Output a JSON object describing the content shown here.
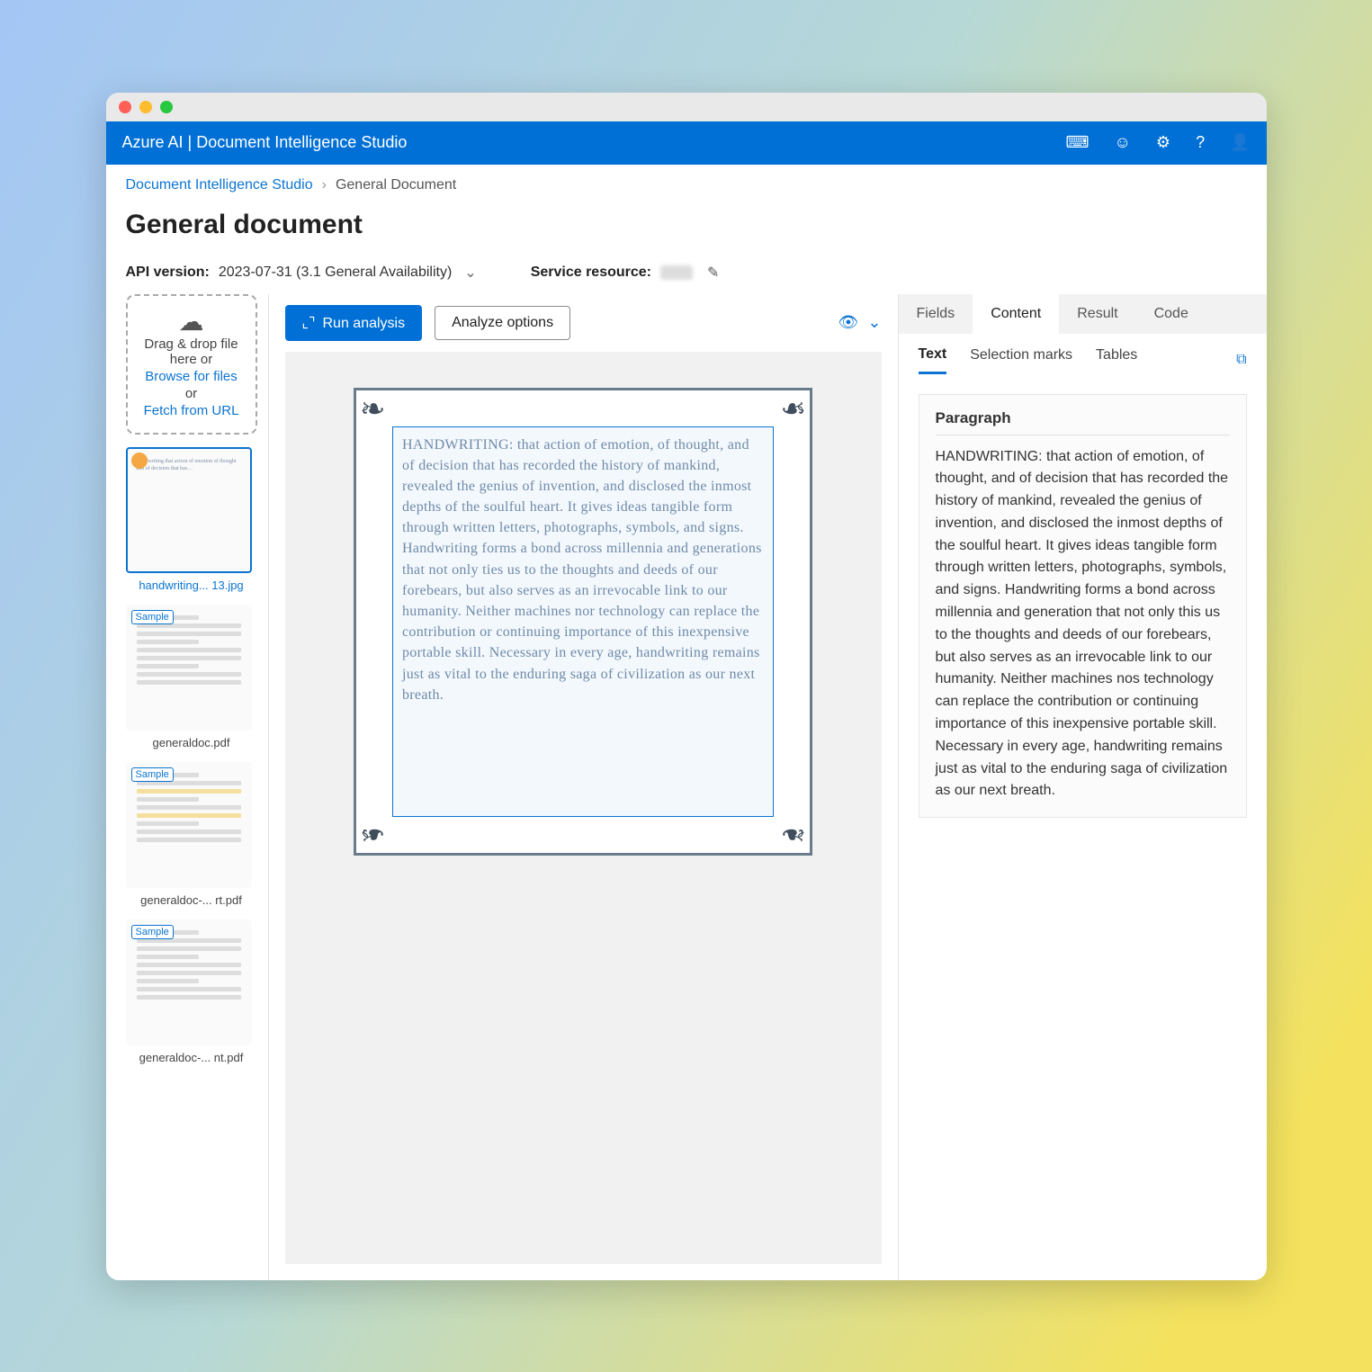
{
  "azure_title": "Azure AI | Document Intelligence Studio",
  "breadcrumb": {
    "root": "Document Intelligence Studio",
    "current": "General Document"
  },
  "page_title": "General document",
  "meta": {
    "api_label": "API version:",
    "api_value": "2023-07-31 (3.1 General Availability)",
    "service_label": "Service resource:"
  },
  "dropzone": {
    "upload_glyph": "⇪",
    "line1": "Drag & drop file here or",
    "browse": "Browse for files",
    "or": "or",
    "fetch": "Fetch from URL"
  },
  "thumbs": [
    {
      "caption": "handwriting... 13.jpg",
      "selected": true,
      "sample": false,
      "kind": "hw"
    },
    {
      "caption": "generaldoc.pdf",
      "selected": false,
      "sample": true,
      "kind": "form"
    },
    {
      "caption": "generaldoc-... rt.pdf",
      "selected": false,
      "sample": true,
      "kind": "form-y"
    },
    {
      "caption": "generaldoc-... nt.pdf",
      "selected": false,
      "sample": true,
      "kind": "form"
    }
  ],
  "toolbar": {
    "run": "Run analysis",
    "options": "Analyze options"
  },
  "doc_text_preview": "HANDWRITING: that action of emotion, of thought, and of decision that has recorded the history of mankind, revealed the genius of invention, and disclosed the inmost depths of the soulful heart. It gives ideas tangible form through written letters, photographs, symbols, and signs. Handwriting forms a bond across millennia and generations that not only ties us to the thoughts and deeds of our forebears, but also serves as an irrevocable link to our humanity. Neither machines nor technology can replace the contribution or continuing importance of this inexpensive portable skill. Necessary in every age, handwriting remains just as vital to the enduring saga of civilization as our next breath.",
  "tabs_primary": [
    "Fields",
    "Content",
    "Result",
    "Code"
  ],
  "tabs_primary_active": "Content",
  "tabs_secondary": [
    "Text",
    "Selection marks",
    "Tables"
  ],
  "tabs_secondary_active": "Text",
  "paragraph_heading": "Paragraph",
  "paragraph_body": "HANDWRITING: that action of emotion, of thought, and of decision that has recorded the history of mankind, revealed the genius of invention, and disclosed the inmost depths of the soulful heart. It gives ideas tangible form through written letters, photographs, symbols, and signs. Handwriting forms a bond across millennia and generation that not only this us to the thoughts and deeds of our forebears, but also serves as an irrevocable link to our humanity. Neither machines nos technology can replace the contribution or continuing importance of this inexpensive portable skill. Necessary in every age, handwriting remains just as vital to the enduring saga of civilization as our next breath.",
  "sample_label": "Sample"
}
